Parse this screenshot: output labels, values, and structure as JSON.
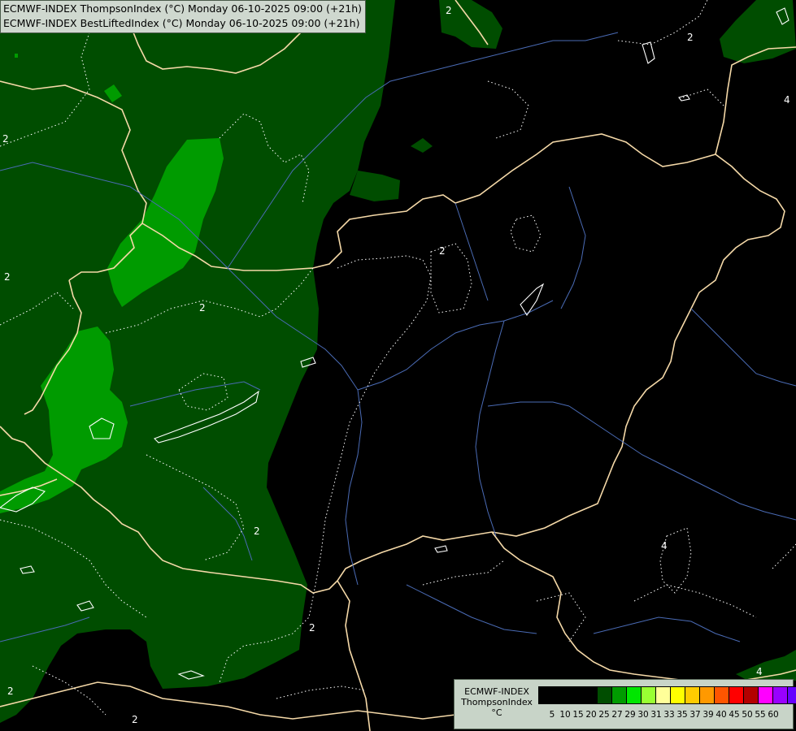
{
  "header": {
    "line1": "ECMWF-INDEX ThompsonIndex (°C) Monday 06-10-2025 09:00 (+21h)",
    "line2": "ECMWF-INDEX BestLiftedIndex (°C) Monday 06-10-2025 09:00 (+21h)"
  },
  "legend": {
    "model": "ECMWF-INDEX",
    "parameter": "ThompsonIndex",
    "unit": "°C",
    "levels": [
      "5",
      "10",
      "15",
      "20",
      "25",
      "27",
      "29",
      "30",
      "31",
      "33",
      "35",
      "37",
      "39",
      "40",
      "45",
      "50",
      "55",
      "60"
    ],
    "colors": [
      "#000000",
      "#000000",
      "#000000",
      "#000000",
      "#004d00",
      "#009b00",
      "#00e600",
      "#99ff33",
      "#ffff99",
      "#ffff00",
      "#ffcc00",
      "#ff9900",
      "#ff5500",
      "#ff0000",
      "#b30000",
      "#ff00ff",
      "#9900ff",
      "#6600ff",
      "#0000ff"
    ]
  },
  "map": {
    "fill_colors": {
      "band_20_25": "#004d00",
      "band_25_27": "#009b00"
    },
    "border_color": "#f5d9a8",
    "river_color": "#4a6bb5",
    "contour_labels": [
      "2",
      "2",
      "2",
      "2",
      "2",
      "2",
      "2",
      "2",
      "2",
      "2",
      "4",
      "4",
      "4"
    ]
  }
}
